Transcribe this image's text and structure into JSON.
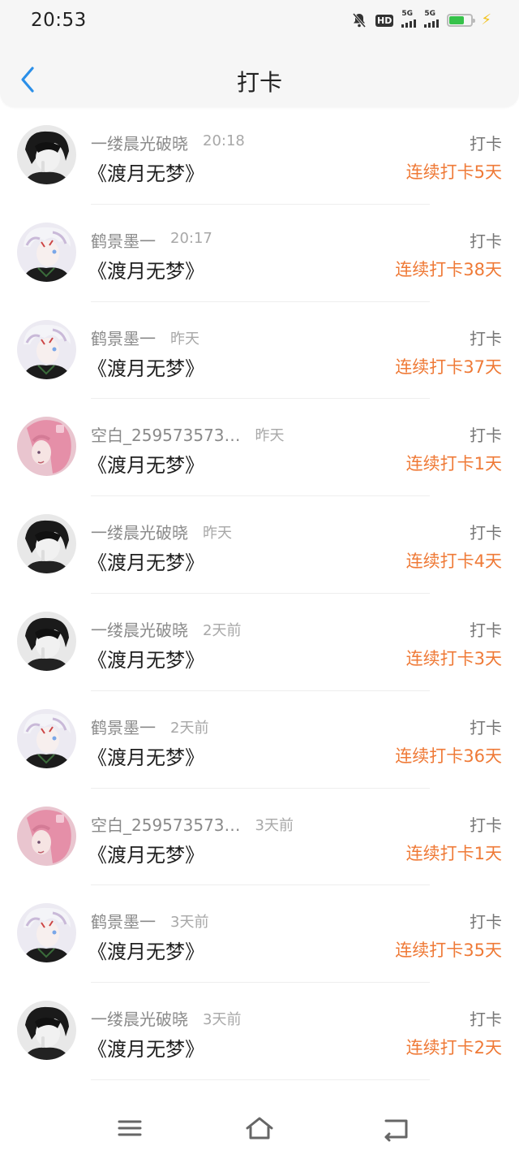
{
  "status_bar": {
    "time": "20:53",
    "network_labels": [
      "5G",
      "5G"
    ],
    "hd_label": "HD",
    "battery_color": "#36c24a"
  },
  "header": {
    "title": "打卡",
    "back_icon": "chevron-left-icon",
    "accent_color": "#2b8fe8"
  },
  "items": [
    {
      "username": "一缕晨光破晓",
      "time": "20:18",
      "book": "《渡月无梦》",
      "type": "打卡",
      "streak": "连续打卡5天",
      "avatar": "dark"
    },
    {
      "username": "鹤景墨一",
      "time": "20:17",
      "book": "《渡月无梦》",
      "type": "打卡",
      "streak": "连续打卡38天",
      "avatar": "white"
    },
    {
      "username": "鹤景墨一",
      "time": "昨天",
      "book": "《渡月无梦》",
      "type": "打卡",
      "streak": "连续打卡37天",
      "avatar": "white"
    },
    {
      "username": "空白_259573573…",
      "time": "昨天",
      "book": "《渡月无梦》",
      "type": "打卡",
      "streak": "连续打卡1天",
      "avatar": "pink"
    },
    {
      "username": "一缕晨光破晓",
      "time": "昨天",
      "book": "《渡月无梦》",
      "type": "打卡",
      "streak": "连续打卡4天",
      "avatar": "dark"
    },
    {
      "username": "一缕晨光破晓",
      "time": "2天前",
      "book": "《渡月无梦》",
      "type": "打卡",
      "streak": "连续打卡3天",
      "avatar": "dark"
    },
    {
      "username": "鹤景墨一",
      "time": "2天前",
      "book": "《渡月无梦》",
      "type": "打卡",
      "streak": "连续打卡36天",
      "avatar": "white"
    },
    {
      "username": "空白_259573573…",
      "time": "3天前",
      "book": "《渡月无梦》",
      "type": "打卡",
      "streak": "连续打卡1天",
      "avatar": "pink"
    },
    {
      "username": "鹤景墨一",
      "time": "3天前",
      "book": "《渡月无梦》",
      "type": "打卡",
      "streak": "连续打卡35天",
      "avatar": "white"
    },
    {
      "username": "一缕晨光破晓",
      "time": "3天前",
      "book": "《渡月无梦》",
      "type": "打卡",
      "streak": "连续打卡2天",
      "avatar": "dark"
    }
  ],
  "colors": {
    "streak": "#ef7a37",
    "username": "#8a8a8a",
    "time": "#a8a8a8"
  },
  "nav_bar": {
    "icons": [
      "menu-icon",
      "home-icon",
      "back-icon"
    ]
  }
}
